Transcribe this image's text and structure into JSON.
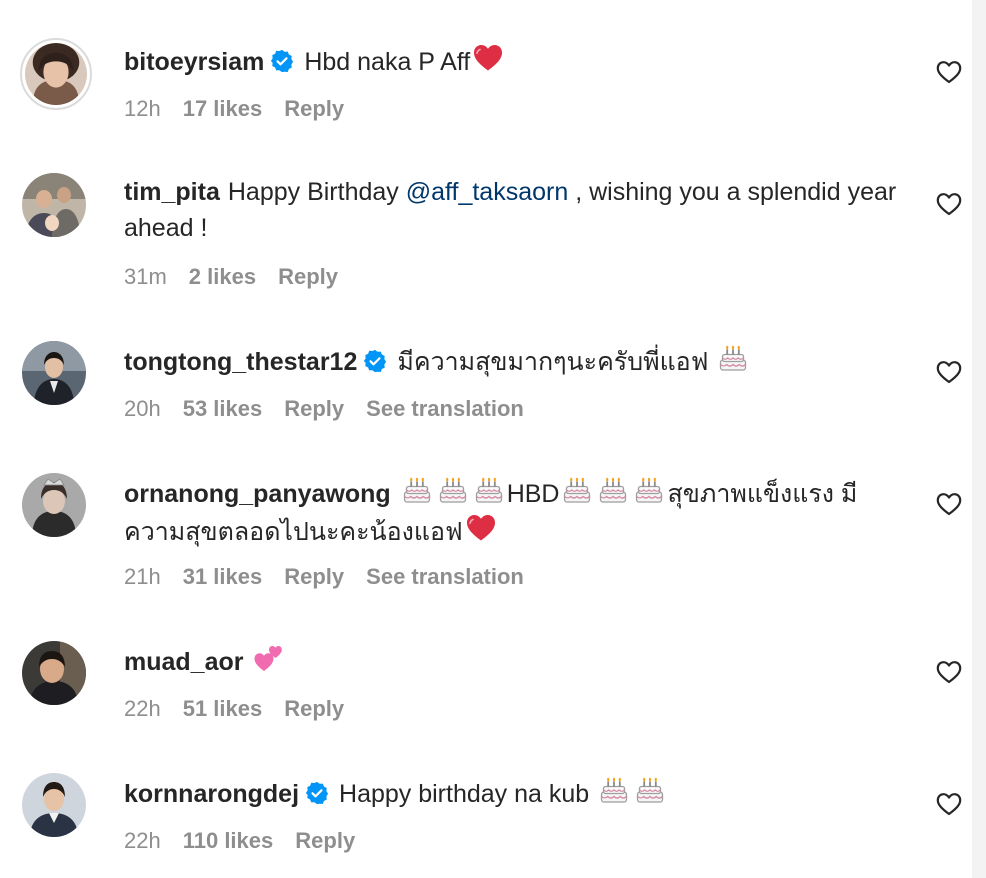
{
  "comments": [
    {
      "username": "bitoeyrsiam",
      "verified": true,
      "text_before": "Hbd naka P Aff",
      "time": "12h",
      "likes": "17 likes",
      "reply": "Reply",
      "see_translation": ""
    },
    {
      "username": "tim_pita",
      "verified": false,
      "text_before": "Happy Birthday ",
      "mention": "@aff_taksaorn",
      "text_after": " , wishing you a splendid year ahead !",
      "time": "31m",
      "likes": "2 likes",
      "reply": "Reply",
      "see_translation": ""
    },
    {
      "username": "tongtong_thestar12",
      "verified": true,
      "text_before": "มีความสุขมากๆนะครับพี่แอฟ ",
      "time": "20h",
      "likes": "53 likes",
      "reply": "Reply",
      "see_translation": "See translation"
    },
    {
      "username": "ornanong_panyawong",
      "verified": false,
      "text_mid1": "HBD",
      "text_mid2": "สุขภาพแข็งแรง มีความสุขตลอดไปนะคะน้องแอฟ",
      "time": "21h",
      "likes": "31 likes",
      "reply": "Reply",
      "see_translation": "See translation"
    },
    {
      "username": "muad_aor",
      "verified": false,
      "time": "22h",
      "likes": "51 likes",
      "reply": "Reply",
      "see_translation": ""
    },
    {
      "username": "kornnarongdej",
      "verified": true,
      "text_before": "Happy birthday na kub ",
      "time": "22h",
      "likes": "110 likes",
      "reply": "Reply",
      "see_translation": ""
    }
  ],
  "icons": {
    "verified": "verified-badge-icon",
    "like": "heart-outline-icon",
    "emoji_heart": "red-heart-emoji",
    "emoji_cake": "birthday-cake-emoji",
    "emoji_two_hearts": "two-hearts-emoji"
  },
  "colors": {
    "text": "#262626",
    "secondary": "#8e8e8e",
    "verified": "#0095f6",
    "mention": "#00376b",
    "heart_emoji": "#e0245e"
  }
}
